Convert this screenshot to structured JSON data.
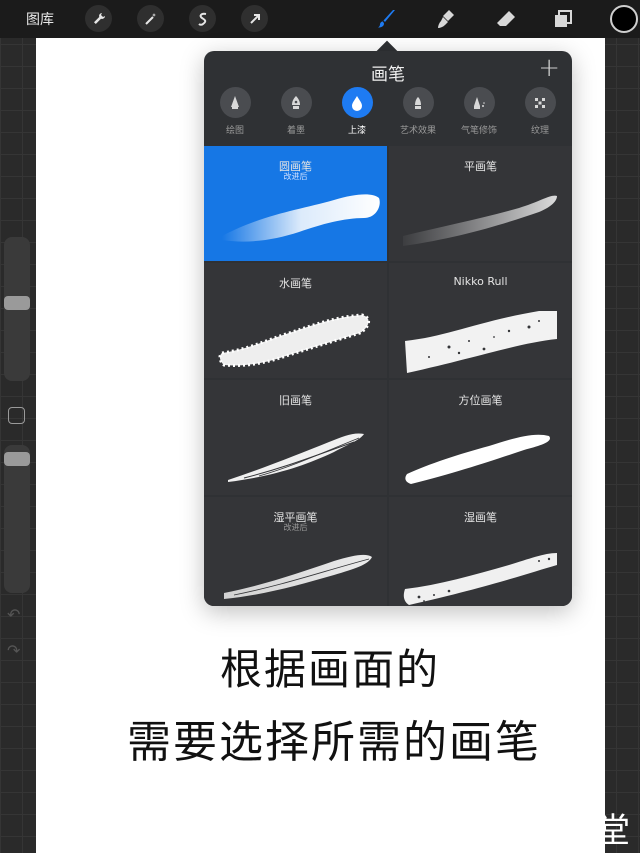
{
  "toolbar": {
    "gallery_label": "图库",
    "tools": [
      "wrench-icon",
      "magic-wand-icon",
      "selection-icon",
      "transform-arrow-icon"
    ],
    "right_tools": [
      "brush-icon",
      "smudge-icon",
      "eraser-icon",
      "layers-icon"
    ],
    "active_tool": "brush-icon",
    "color": "#000000"
  },
  "sidebar": {
    "brush_size_level": 0.45,
    "opacity_level": 0.05
  },
  "brush_library": {
    "title": "画笔",
    "add_label": "+",
    "categories": [
      {
        "label": "绘图",
        "icon": "pencil-nib-icon"
      },
      {
        "label": "着墨",
        "icon": "ink-pen-icon"
      },
      {
        "label": "上漆",
        "icon": "paint-drop-icon"
      },
      {
        "label": "艺术效果",
        "icon": "art-pen-icon"
      },
      {
        "label": "气笔修饰",
        "icon": "airbrush-icon"
      },
      {
        "label": "纹理",
        "icon": "texture-icon"
      }
    ],
    "active_category": 2,
    "brushes": [
      {
        "name": "圆画笔",
        "sub": "改进后",
        "selected": true
      },
      {
        "name": "平画笔",
        "sub": "",
        "selected": false
      },
      {
        "name": "水画笔",
        "sub": "",
        "selected": false
      },
      {
        "name": "Nikko Rull",
        "sub": "",
        "selected": false
      },
      {
        "name": "旧画笔",
        "sub": "",
        "selected": false
      },
      {
        "name": "方位画笔",
        "sub": "",
        "selected": false
      },
      {
        "name": "湿平画笔",
        "sub": "改进后",
        "selected": false
      },
      {
        "name": "湿画笔",
        "sub": "",
        "selected": false
      }
    ]
  },
  "caption": {
    "line1": "根据画面的",
    "line2": "需要选择所需的画笔"
  },
  "watermark": "堂",
  "colors": {
    "accent": "#1e7bf2",
    "selected_cell": "#1677e5",
    "popover_bg": "#2f3134"
  }
}
